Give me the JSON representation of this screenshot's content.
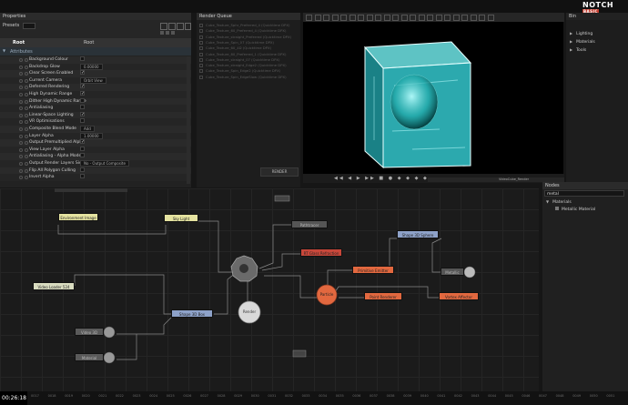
{
  "app": {
    "logo": "NOTCH",
    "edition": "BASIC"
  },
  "properties": {
    "title": "Properties",
    "presets_label": "Presets",
    "root_label": "Root",
    "root_value": "Root",
    "section_label": "Attributes",
    "rows": [
      {
        "label": "Background Colour",
        "value": ""
      },
      {
        "label": "Backdrop Glow",
        "value": "0.00000"
      },
      {
        "label": "Clear Screen Enabled",
        "value": "✓"
      },
      {
        "label": "Current Camera",
        "value": "Orbit View"
      },
      {
        "label": "Deferred Rendering",
        "value": "✓"
      },
      {
        "label": "High Dynamic Range",
        "value": "✓"
      },
      {
        "label": "Dither High Dynamic Range",
        "value": ""
      },
      {
        "label": "Antialiasing",
        "value": ""
      },
      {
        "label": "Linear-Space Lighting",
        "value": "✓"
      },
      {
        "label": "VR Optimisations",
        "value": ""
      },
      {
        "label": "Composite Blend Mode",
        "value": "Add"
      },
      {
        "label": "Layer Alpha",
        "value": "1.00000"
      },
      {
        "label": "Output Premultiplied Alpha",
        "value": "✓"
      },
      {
        "label": "View Layer Alpha",
        "value": ""
      },
      {
        "label": "Antialiasing - Alpha Mode",
        "value": ""
      },
      {
        "label": "Output Render Layers Side By Side",
        "value": "No - Output Composite"
      },
      {
        "label": "Flip All Polygon Culling",
        "value": ""
      },
      {
        "label": "Invert Alpha",
        "value": ""
      }
    ]
  },
  "render_queue": {
    "title": "Render Queue",
    "items": [
      "Cube_Texture_Sphr_Preferred_4 (Quicktime DPX)",
      "Cube_Texture_60_Preferred_4 (Quicktime DPX)",
      "Cube_Texture_straight_Preferred (Quicktime DPX)",
      "Cube_Texture_Spin_07 (Quicktime DPX)",
      "Cube_Texture_60_4D (Quicktime DPX)",
      "Cube_Texture_60_Preferred_1 (Quicktime DPX)",
      "Cube_Texture_straight_07 (Quicktime DPX)",
      "Cube_Texture_straight_Edge2 (Quicktime DPX)",
      "Cube_Texture_Spin_Edge2 (Quicktime DPX)",
      "Cube_Texture_Spin_EdgeSlow (Quicktime DPX)"
    ],
    "render_button": "RENDER"
  },
  "bin": {
    "title": "Bin",
    "items": [
      "Lighting",
      "Materials",
      "Tools"
    ]
  },
  "viewport": {
    "layer_label": "VideoCube_Render"
  },
  "nodes_panel": {
    "title": "Nodes",
    "search_value": "metal",
    "category": "Materials",
    "items": [
      "Metallic Material"
    ]
  },
  "graph": {
    "nodes": [
      {
        "label": "Environment Image"
      },
      {
        "label": "Sky Light"
      },
      {
        "label": "Video Loader 524"
      },
      {
        "label": "Shape 3D Box"
      },
      {
        "label": "Render"
      },
      {
        "label": "Pathtracer"
      },
      {
        "label": "RT Glass Refraction"
      },
      {
        "label": "Shape 3D Sphere"
      },
      {
        "label": "Primitive Emitter"
      },
      {
        "label": "Particle"
      },
      {
        "label": "Point Renderer"
      },
      {
        "label": "Vortex Affector"
      },
      {
        "label": "Metallic"
      },
      {
        "label": "Video 3D"
      },
      {
        "label": "Material"
      }
    ]
  },
  "timeline": {
    "current_time": "00:26:18",
    "ticks": [
      "0017",
      "0018",
      "0019",
      "0020",
      "0021",
      "0022",
      "0023",
      "0024",
      "0025",
      "0026",
      "0027",
      "0028",
      "0029",
      "0030",
      "0031",
      "0032",
      "0033",
      "0034",
      "0035",
      "0036",
      "0037",
      "0038",
      "0039",
      "0040",
      "0041",
      "0042",
      "0043",
      "0044",
      "0045",
      "0046",
      "0047",
      "0048",
      "0049",
      "0050",
      "0051"
    ]
  },
  "colors": {
    "accent": "#c0392b",
    "cube": "#3fd1d6",
    "node_yellow": "#e5e3a0",
    "node_blue": "#8ea2c9",
    "node_orange": "#e2683f",
    "node_red": "#c8473a"
  }
}
